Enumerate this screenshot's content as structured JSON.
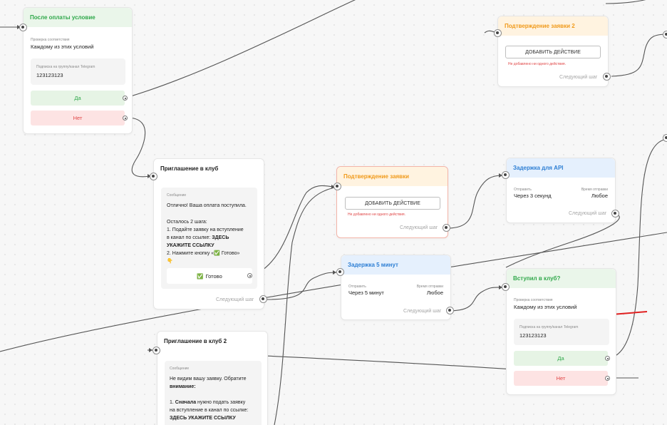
{
  "cards": {
    "after_payment": {
      "title": "После оплаты условие",
      "check_label": "Проверка соответствия",
      "check_value": "Каждому из этих условий",
      "sub_label": "Подписка на группу/канал Telegram",
      "sub_value": "123123123",
      "yes": "Да",
      "no": "Нет"
    },
    "confirm2": {
      "title": "Подтверждение заявки 2",
      "add_action": "ДОБАВИТЬ ДЕЙСТВИЕ",
      "error": "Не добавлено ни одного действия.",
      "next": "Следующий шаг"
    },
    "invite": {
      "title": "Приглашение в клуб",
      "msg_label": "Сообщение",
      "line1": "Отлично! Ваша оплата поступила.",
      "line2": "Осталось 2 шага:",
      "line3a": "1. Подайте заявку на вступление",
      "line3b": "в канал по ссылке: ",
      "line3c": "ЗДЕСЬ",
      "line3d": "УКАЖИТЕ ССЫЛКУ",
      "line4": "2. Нажмите кнопку «",
      "line4b": " Готово»",
      "check_emoji": "✅",
      "point_emoji": "👇",
      "ready_btn": "Готово",
      "next": "Следующий шаг"
    },
    "confirm": {
      "title": "Подтверждение заявки",
      "add_action": "ДОБАВИТЬ ДЕЙСТВИЕ",
      "error": "Не добавлено ни одного действия.",
      "next": "Следующий шаг"
    },
    "delay_api": {
      "title": "Задержка для API",
      "send_label": "Отправить",
      "send_value": "Через 3 секунд",
      "time_label": "Время отправки",
      "time_value": "Любое",
      "next": "Следующий шаг"
    },
    "delay5": {
      "title": "Задержка 5 минут",
      "send_label": "Отправить",
      "send_value": "Через 5 минут",
      "time_label": "Время отправки",
      "time_value": "Любое",
      "next": "Следующий шаг"
    },
    "joined": {
      "title": "Вступил в клуб?",
      "check_label": "Проверка соответствия",
      "check_value": "Каждому из этих условий",
      "sub_label": "Подписка на группу/канал Telegram",
      "sub_value": "123123123",
      "yes": "Да",
      "no": "Нет"
    },
    "invite2": {
      "title": "Приглашение в клуб 2",
      "msg_label": "Сообщение",
      "line1": "Не видим вашу заявку. Обратите",
      "line2": "внимание:",
      "line3a": "1. ",
      "line3b": "Сначала",
      "line3c": " нужно подать заявку",
      "line4": "на вступление в канал по ссылке:",
      "line5": "ЗДЕСЬ УКАЖИТЕ ССЫЛКУ"
    }
  },
  "colors": {
    "edge": "#555555",
    "annotation_arrow": "#e02020"
  }
}
